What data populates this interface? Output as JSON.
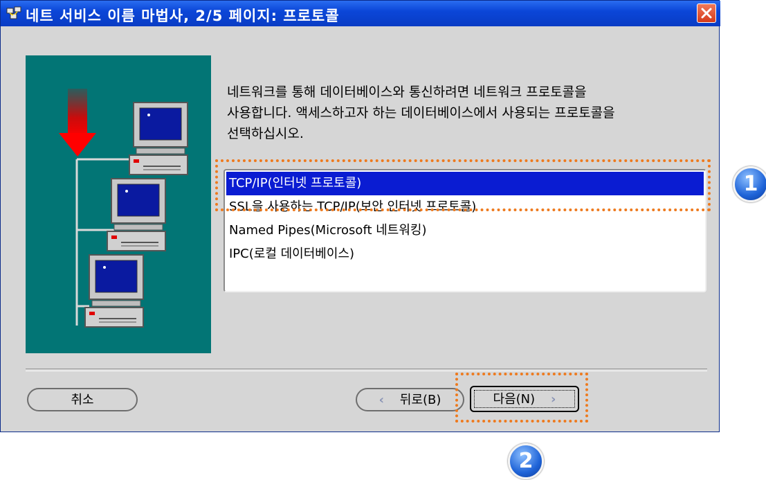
{
  "window": {
    "title": "네트 서비스 이름 마법사, 2/5 페이지: 프로토콜"
  },
  "description": "네트워크를 통해 데이터베이스와 통신하려면 네트워크 프로토콜을\n사용합니다. 액세스하고자 하는 데이터베이스에서 사용되는 프로토콜을\n선택하십시오.",
  "protocols": [
    {
      "label": "TCP/IP(인터넷 프로토콜)",
      "selected": true
    },
    {
      "label": "SSL을 사용하는 TCP/IP(보안 인터넷 프로토콜)",
      "selected": false
    },
    {
      "label": "Named Pipes(Microsoft 네트워킹)",
      "selected": false
    },
    {
      "label": "IPC(로컬 데이터베이스)",
      "selected": false
    }
  ],
  "buttons": {
    "cancel": "취소",
    "back": "뒤로(B)",
    "next": "다음(N)"
  },
  "callouts": {
    "one": "1",
    "two": "2"
  },
  "colors": {
    "selection": "#0a1cd2",
    "illustration_bg": "#027575",
    "callout": "#ee7a1e",
    "titlebar": "#0b46d8"
  }
}
